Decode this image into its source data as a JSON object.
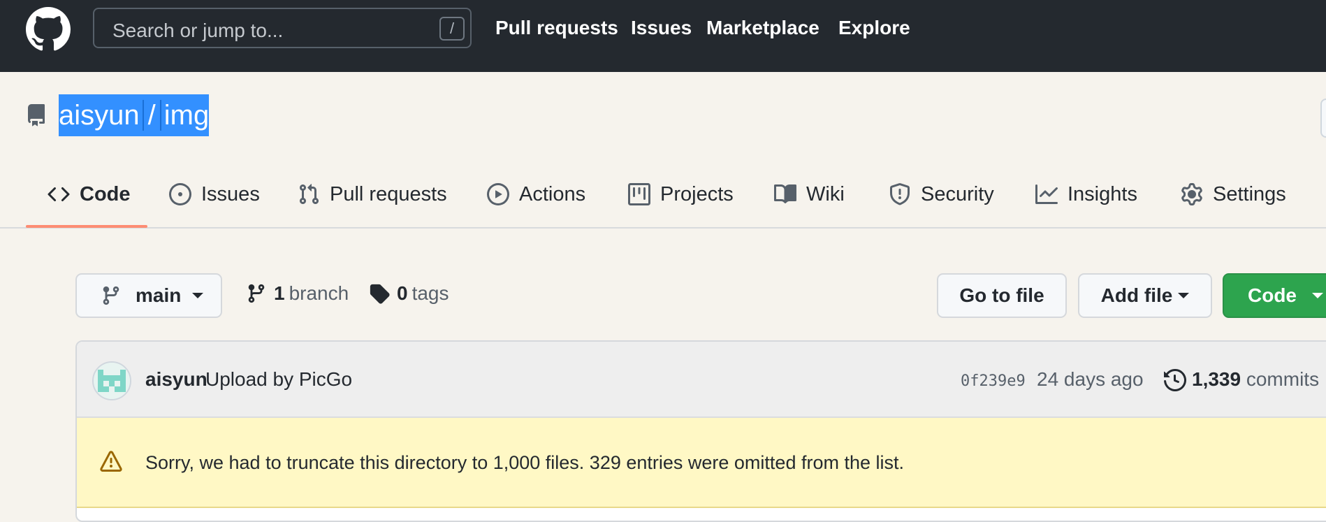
{
  "header": {
    "search_placeholder": "Search or jump to...",
    "search_shortcut": "/",
    "nav": [
      "Pull requests",
      "Issues",
      "Marketplace",
      "Explore"
    ]
  },
  "repo": {
    "owner": "aisyun",
    "separator": "/",
    "name": "img"
  },
  "tabs": [
    {
      "label": "Code",
      "icon": "code-icon",
      "selected": true
    },
    {
      "label": "Issues",
      "icon": "issue-icon"
    },
    {
      "label": "Pull requests",
      "icon": "pull-request-icon"
    },
    {
      "label": "Actions",
      "icon": "play-icon"
    },
    {
      "label": "Projects",
      "icon": "project-icon"
    },
    {
      "label": "Wiki",
      "icon": "book-icon"
    },
    {
      "label": "Security",
      "icon": "shield-icon"
    },
    {
      "label": "Insights",
      "icon": "graph-icon"
    },
    {
      "label": "Settings",
      "icon": "gear-icon"
    }
  ],
  "file_nav": {
    "branch_current": "main",
    "branch_count": "1",
    "branch_label": "branch",
    "tag_count": "0",
    "tag_label": "tags",
    "goto_file": "Go to file",
    "add_file": "Add file",
    "code": "Code"
  },
  "latest_commit": {
    "author": "aisyun",
    "message": "Upload by PicGo",
    "sha": "0f239e9",
    "age": "24 days ago",
    "commit_count": "1,339",
    "commit_label": "commits"
  },
  "flash": {
    "text": "Sorry, we had to truncate this directory to 1,000 files. 329 entries were omitted from the list."
  },
  "colors": {
    "header_bg": "#24292f",
    "page_bg": "#f6f3ed",
    "selection": "#3390ff",
    "tab_underline": "#fd8c73",
    "primary_button": "#2da44e",
    "flash_bg": "#fff8c5",
    "warn_icon": "#9a6700"
  }
}
